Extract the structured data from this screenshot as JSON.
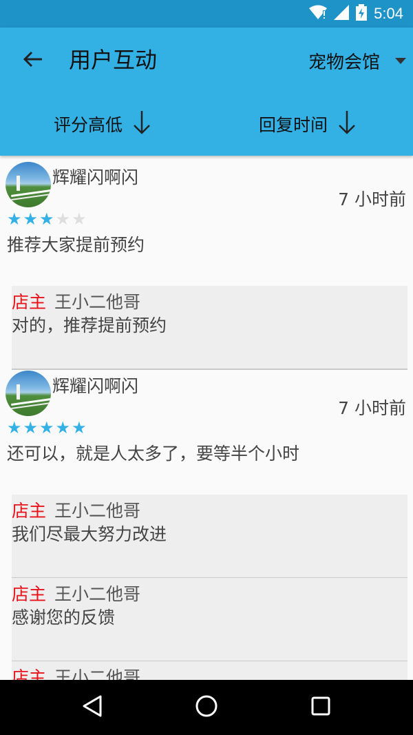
{
  "status_bar": {
    "time": "5:04"
  },
  "app_bar": {
    "title": "用户互动",
    "shop": "宠物会馆",
    "sort_rating": "评分高低",
    "sort_reply_time": "回复时间"
  },
  "reviews": [
    {
      "username": "辉耀闪啊闪",
      "time": "7 小时前",
      "rating": 3,
      "max_rating": 5,
      "text": "推荐大家提前预约",
      "replies": [
        {
          "tag": "店主",
          "name": "王小二他哥",
          "text": "对的，推荐提前预约"
        }
      ]
    },
    {
      "username": "辉耀闪啊闪",
      "time": "7 小时前",
      "rating": 5,
      "max_rating": 5,
      "text": "还可以，就是人太多了，要等半个小时",
      "replies": [
        {
          "tag": "店主",
          "name": "王小二他哥",
          "text": "我们尽最大努力改进"
        },
        {
          "tag": "店主",
          "name": "王小二他哥",
          "text": "感谢您的反馈"
        },
        {
          "tag": "店主",
          "name": "王小二他哥",
          "text": ""
        }
      ]
    }
  ],
  "colors": {
    "accent": "#33b1e5",
    "status_bar": "#1e93c8",
    "owner_tag": "#e8121b",
    "reply_bg": "#eeeeee"
  },
  "icons": [
    "wifi-icon",
    "signal-icon",
    "battery-icon",
    "back-arrow-icon",
    "dropdown-icon",
    "arrow-down-icon",
    "nav-back-icon",
    "nav-home-icon",
    "nav-recents-icon",
    "star-icon"
  ]
}
